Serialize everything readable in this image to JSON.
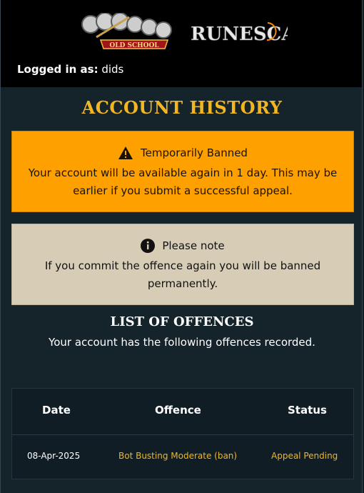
{
  "header": {
    "logged_in_label": "Logged in as:",
    "username": "dids",
    "logo_oldschool": {
      "word1": "RUNE",
      "word2": "SCAPE",
      "banner": "OLD SCHOOL"
    },
    "logo_runescape": "RUNESCAPE"
  },
  "page": {
    "title": "ACCOUNT HISTORY"
  },
  "ban_alert": {
    "heading": "Temporarily Banned",
    "body": "Your account will be available again in 1 day. This may be earlier if you submit a successful appeal.",
    "color": "#fda000"
  },
  "note_alert": {
    "heading": "Please note",
    "body": "If you commit the offence again you will be banned permanently.",
    "color": "#d7cdb7"
  },
  "offences": {
    "title": "LIST OF OFFENCES",
    "subtitle": "Your account has the following offences recorded.",
    "columns": [
      "Date",
      "Offence",
      "Status"
    ],
    "rows": [
      {
        "date": "08-Apr-2025",
        "offence": "Bot Busting Moderate (ban)",
        "status": "Appeal Pending"
      }
    ]
  },
  "colors": {
    "accent_gold": "#f2b622",
    "background": "#15232b",
    "topbar": "#000000"
  },
  "icons": {
    "ban": "warning-triangle-icon",
    "note": "info-circle-icon"
  }
}
